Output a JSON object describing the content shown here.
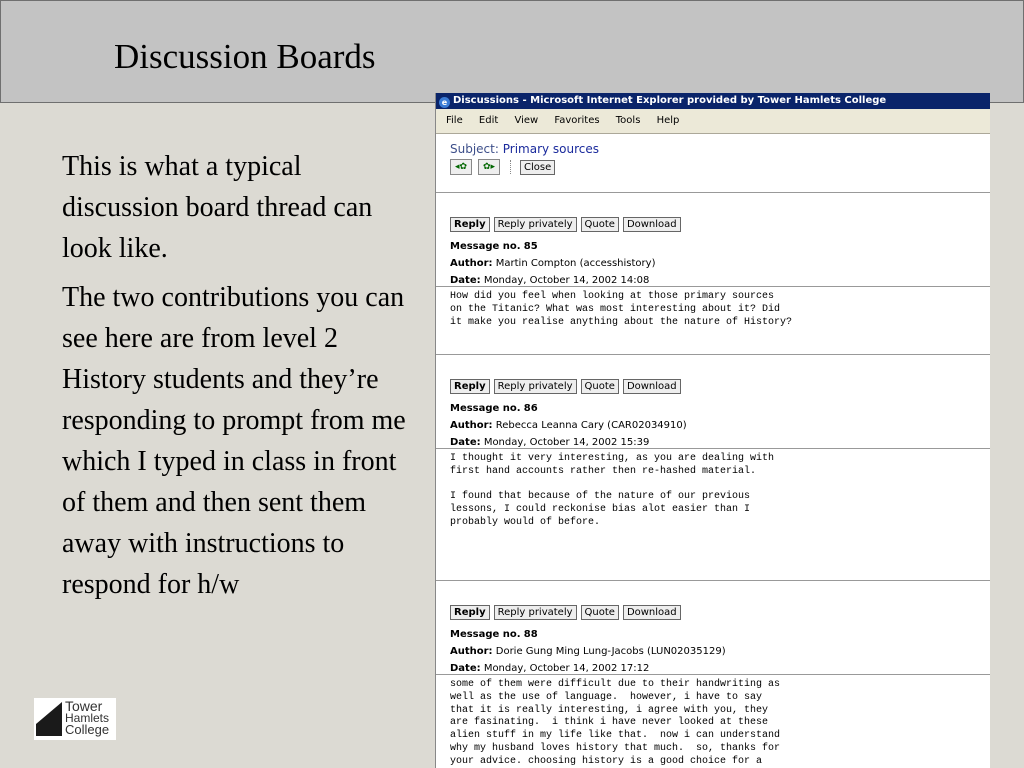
{
  "slide": {
    "title": "Discussion Boards",
    "paragraphs": [
      "This is what a typical discussion board thread can look like.",
      "The two contributions you can see here are from level 2 History students and they’re responding to prompt from me which I typed in class in front of them and then sent them away with instructions to respond for h/w"
    ],
    "logo": {
      "line1": "Tower",
      "line2": "Hamlets",
      "line3": "College"
    }
  },
  "browser": {
    "window_title": "Discussions - Microsoft Internet Explorer provided by Tower Hamlets College",
    "menu": [
      "File",
      "Edit",
      "View",
      "Favorites",
      "Tools",
      "Help"
    ],
    "subject_label": "Subject:",
    "subject_value": "Primary sources",
    "close_label": "Close",
    "prev_icon": "prev-arrow-icon",
    "next_icon": "next-arrow-icon"
  },
  "actions": {
    "reply": "Reply",
    "reply_privately": "Reply privately",
    "quote": "Quote",
    "download": "Download"
  },
  "labels": {
    "message_no": "Message no.",
    "author": "Author:",
    "date": "Date:"
  },
  "messages": [
    {
      "number": "85",
      "author": "Martin Compton (accesshistory)",
      "date": "Monday, October 14, 2002 14:08",
      "body": "How did you feel when looking at those primary sources\non the Titanic? What was most interesting about it? Did\nit make you realise anything about the nature of History?"
    },
    {
      "number": "86",
      "author": "Rebecca Leanna Cary (CAR02034910)",
      "date": "Monday, October 14, 2002 15:39",
      "body": "I thought it very interesting, as you are dealing with\nfirst hand accounts rather then re-hashed material.\n\nI found that because of the nature of our previous\nlessons, I could reckonise bias alot easier than I\nprobably would of before."
    },
    {
      "number": "88",
      "author": "Dorie Gung Ming Lung-Jacobs (LUN02035129)",
      "date": "Monday, October 14, 2002 17:12",
      "body": "some of them were difficult due to their handwriting as\nwell as the use of language.  however, i have to say\nthat it is really interesting, i agree with you, they\nare fasinating.  i think i have never looked at these\nalien stuff in my life like that.  now i can understand\nwhy my husband loves history that much.  so, thanks for\nyour advice. choosing history is a good choice for a"
    }
  ]
}
